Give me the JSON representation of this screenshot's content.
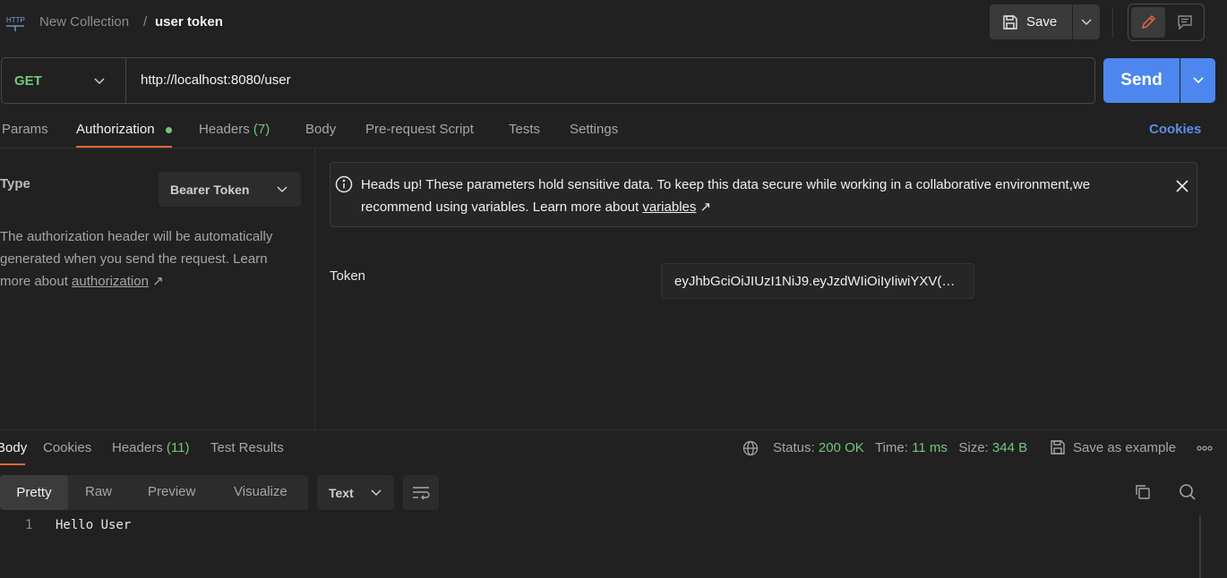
{
  "header": {
    "icon": "http-icon",
    "collection": "New Collection",
    "separator": "/",
    "request_name": "user token",
    "save_label": "Save"
  },
  "request": {
    "method": "GET",
    "url": "http://localhost:8080/user",
    "send_label": "Send"
  },
  "tabs": [
    {
      "label": "Params"
    },
    {
      "label": "Authorization",
      "active": true,
      "dot": true
    },
    {
      "label": "Headers",
      "count": "(7)"
    },
    {
      "label": "Body"
    },
    {
      "label": "Pre-request Script"
    },
    {
      "label": "Tests"
    },
    {
      "label": "Settings"
    }
  ],
  "cookies_label": "Cookies",
  "auth": {
    "type_label": "Type",
    "type_value": "Bearer Token",
    "desc_text": "The authorization header will be automatically generated when you send the request. Learn more about ",
    "desc_link": "authorization",
    "arrow": "↗"
  },
  "alert": {
    "text": "Heads up! These parameters hold sensitive data. To keep this data secure while working in a collaborative environment,we recommend using variables. Learn more about ",
    "link": "variables",
    "arrow": "↗"
  },
  "token": {
    "label": "Token",
    "value": "eyJhbGciOiJIUzI1NiJ9.eyJzdWIiOiIyIiwiYXV(…"
  },
  "response": {
    "tabs": [
      {
        "label": "Body",
        "active": true
      },
      {
        "label": "Cookies"
      },
      {
        "label": "Headers",
        "count": "(11)"
      },
      {
        "label": "Test Results"
      }
    ],
    "status_label": "Status:",
    "status_value": "200 OK",
    "time_label": "Time:",
    "time_value": "11 ms",
    "size_label": "Size:",
    "size_value": "344 B",
    "save_example": "Save as example",
    "views": [
      "Pretty",
      "Raw",
      "Preview",
      "Visualize"
    ],
    "format": "Text",
    "lines": [
      {
        "num": "1",
        "text": "Hello User"
      }
    ]
  },
  "colors": {
    "background": "#212121",
    "accent": "#e8673a",
    "send": "#4d86ee",
    "success": "#74c77a",
    "link": "#5a8fe8"
  }
}
